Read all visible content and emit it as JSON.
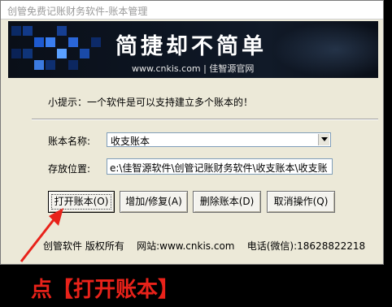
{
  "window": {
    "title": "创管免费记账财务软件-账本管理"
  },
  "banner": {
    "slogan": "简捷却不简单",
    "site": "www.cnkis.com | 佳智源官网"
  },
  "hint": "小提示：一个软件是可以支持建立多个账本的！",
  "form": {
    "name_label": "账本名称:",
    "name_value": "收支账本",
    "path_label": "存放位置:",
    "path_value": "e:\\佳智源软件\\创管记账财务软件\\收支账本\\收支账"
  },
  "buttons": {
    "open": "打开账本(O)",
    "add_edit": "增加/修复(A)",
    "delete": "删除账本(D)",
    "cancel": "取消操作(Q)"
  },
  "footer": {
    "company": "创管软件  版权所有",
    "website": "网站:www.cnkis.com",
    "phone": "电话(微信):18628822218"
  },
  "annotation": {
    "caption": "点【打开账本】",
    "color": "#e8221a"
  }
}
